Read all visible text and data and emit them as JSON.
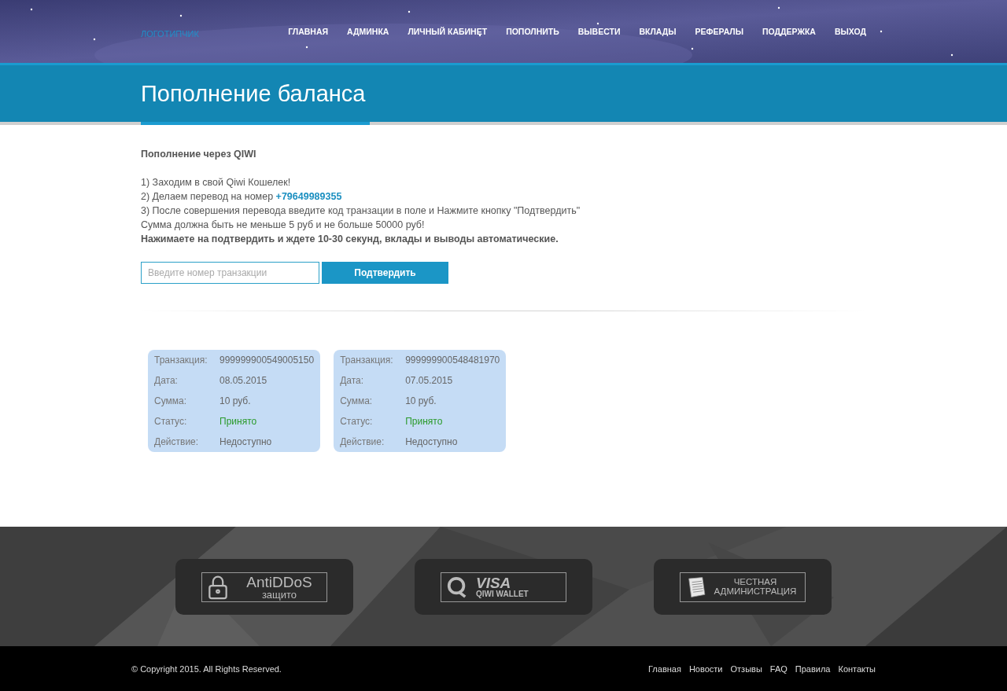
{
  "header": {
    "logo": "ЛОГОТИПЧИК",
    "nav": [
      "ГЛАВНАЯ",
      "АДМИНКА",
      "ЛИЧНЫЙ КАБИНЕТ",
      "ПОПОЛНИТЬ",
      "ВЫВЕСТИ",
      "ВКЛАДЫ",
      "РЕФЕРАЛЫ",
      "ПОДДЕРЖКА",
      "ВЫХОД"
    ]
  },
  "page_title": "Пополнение баланса",
  "instructions": {
    "heading": "Пополнение через QIWI",
    "lines": [
      "1) Заходим в свой Qiwi Кошелек!",
      "2) Делаем перевод на номер **+79649989355**",
      "3) После совершения перевода введите код транзации в поле и Нажмите кнопку \"Подтвердить\"",
      "Сумма должна быть не меньше 5 руб и не больше 50000 руб!"
    ],
    "note": "Нажимаете на подтвердить и ждете 10-30 секунд, вклады и выводы автоматические."
  },
  "form": {
    "placeholder": "Введите номер транзакции",
    "button": "Подтвердить"
  },
  "transactions": [
    {
      "fields": [
        {
          "label": "Транзакция:",
          "value": "999999900549005150",
          "kind": "plain"
        },
        {
          "label": "Дата:",
          "value": "08.05.2015",
          "kind": "plain"
        },
        {
          "label": "Сумма:",
          "value": "10 руб.",
          "kind": "plain"
        },
        {
          "label": "Статус:",
          "value": "Принято",
          "kind": "status"
        },
        {
          "label": "Действие:",
          "value": "Недоступно",
          "kind": "plain"
        }
      ]
    },
    {
      "fields": [
        {
          "label": "Транзакция:",
          "value": "999999900548481970",
          "kind": "plain"
        },
        {
          "label": "Дата:",
          "value": "07.05.2015",
          "kind": "plain"
        },
        {
          "label": "Сумма:",
          "value": "10 руб.",
          "kind": "plain"
        },
        {
          "label": "Статус:",
          "value": "Принято",
          "kind": "status"
        },
        {
          "label": "Действие:",
          "value": "Недоступно",
          "kind": "plain"
        }
      ]
    }
  ],
  "badges": [
    {
      "kind": "antiddos",
      "lines": [
        "AntiDDoS",
        "защито"
      ]
    },
    {
      "kind": "qiwi",
      "lines": [
        "VISA",
        "QIWI WALLET"
      ]
    },
    {
      "kind": "admin",
      "lines": [
        "ЧЕСТНАЯ",
        "АДМИНИСТРАЦИЯ"
      ]
    }
  ],
  "footer": {
    "copyright": "© Copyright 2015. All Rights Reserved.",
    "links": [
      "Главная",
      "Новости",
      "Отзывы",
      "FAQ",
      "Правила",
      "Контакты"
    ]
  }
}
